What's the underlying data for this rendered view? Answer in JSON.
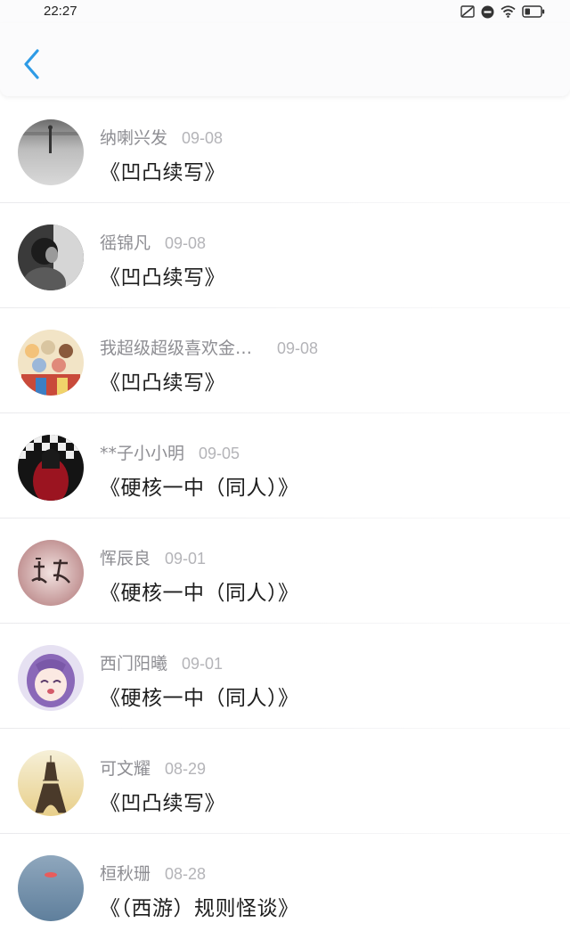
{
  "status_bar": {
    "time": "22:27",
    "icons": [
      "no-sim-icon",
      "do-not-disturb-icon",
      "wifi-icon",
      "battery-icon"
    ]
  },
  "header": {
    "back_icon": "chevron-left-icon",
    "accent": "#2e9be6"
  },
  "list": [
    {
      "name": "纳喇兴发",
      "date": "09-08",
      "title": "《凹凸续写》",
      "avatar": "avatar-gray-figure"
    },
    {
      "name": "徭锦凡",
      "date": "09-08",
      "title": "《凹凸续写》",
      "avatar": "avatar-bw-portrait"
    },
    {
      "name": "我超级超级喜欢金…",
      "date": "09-08",
      "title": "《凹凸续写》",
      "avatar": "avatar-anime-group"
    },
    {
      "name": "**子小小明",
      "date": "09-05",
      "title": "《硬核一中（同人）》",
      "avatar": "avatar-red-dress"
    },
    {
      "name": "恽辰良",
      "date": "09-01",
      "title": "《硬核一中（同人）》",
      "avatar": "avatar-pink-calligraphy"
    },
    {
      "name": "西门阳曦",
      "date": "09-01",
      "title": "《硬核一中（同人）》",
      "avatar": "avatar-anime-girl"
    },
    {
      "name": "可文耀",
      "date": "08-29",
      "title": "《凹凸续写》",
      "avatar": "avatar-eiffel-tower"
    },
    {
      "name": "桓秋珊",
      "date": "08-28",
      "title": "《（西游）规则怪谈》",
      "avatar": "avatar-blue-sky"
    }
  ]
}
